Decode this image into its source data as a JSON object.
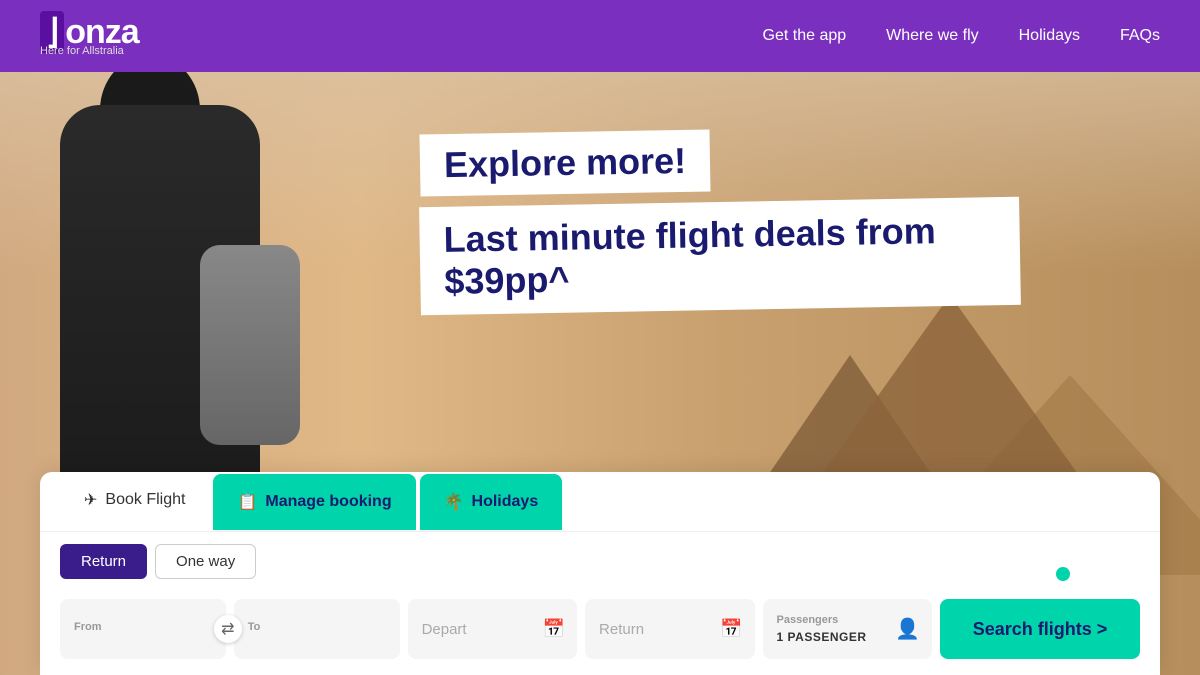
{
  "navbar": {
    "logo": "Bonza",
    "tagline": "Here for Allstralia",
    "links": [
      {
        "id": "get-app",
        "label": "Get the app"
      },
      {
        "id": "where-we-fly",
        "label": "Where we fly"
      },
      {
        "id": "holidays",
        "label": "Holidays"
      },
      {
        "id": "faqs",
        "label": "FAQs"
      }
    ]
  },
  "hero": {
    "headline1": "Explore more!",
    "headline2": "Last minute flight deals from $39pp^"
  },
  "booking": {
    "tabs": [
      {
        "id": "book-flight",
        "label": "Book Flight",
        "icon": "✈"
      },
      {
        "id": "manage-booking",
        "label": "Manage booking",
        "icon": "📋"
      },
      {
        "id": "holidays",
        "label": "Holidays",
        "icon": "🌴"
      }
    ],
    "trip_types": [
      {
        "id": "return",
        "label": "Return"
      },
      {
        "id": "one-way",
        "label": "One way"
      }
    ],
    "selected_trip": "return",
    "fields": {
      "from_label": "From",
      "from_placeholder": "",
      "to_label": "To",
      "to_placeholder": "",
      "depart_label": "Depart",
      "depart_placeholder": "Depart",
      "return_label": "Return",
      "return_placeholder": "Return",
      "passengers_label": "Passengers",
      "passengers_value": "1 PASSENGER"
    },
    "search_button": "Search flights >"
  }
}
